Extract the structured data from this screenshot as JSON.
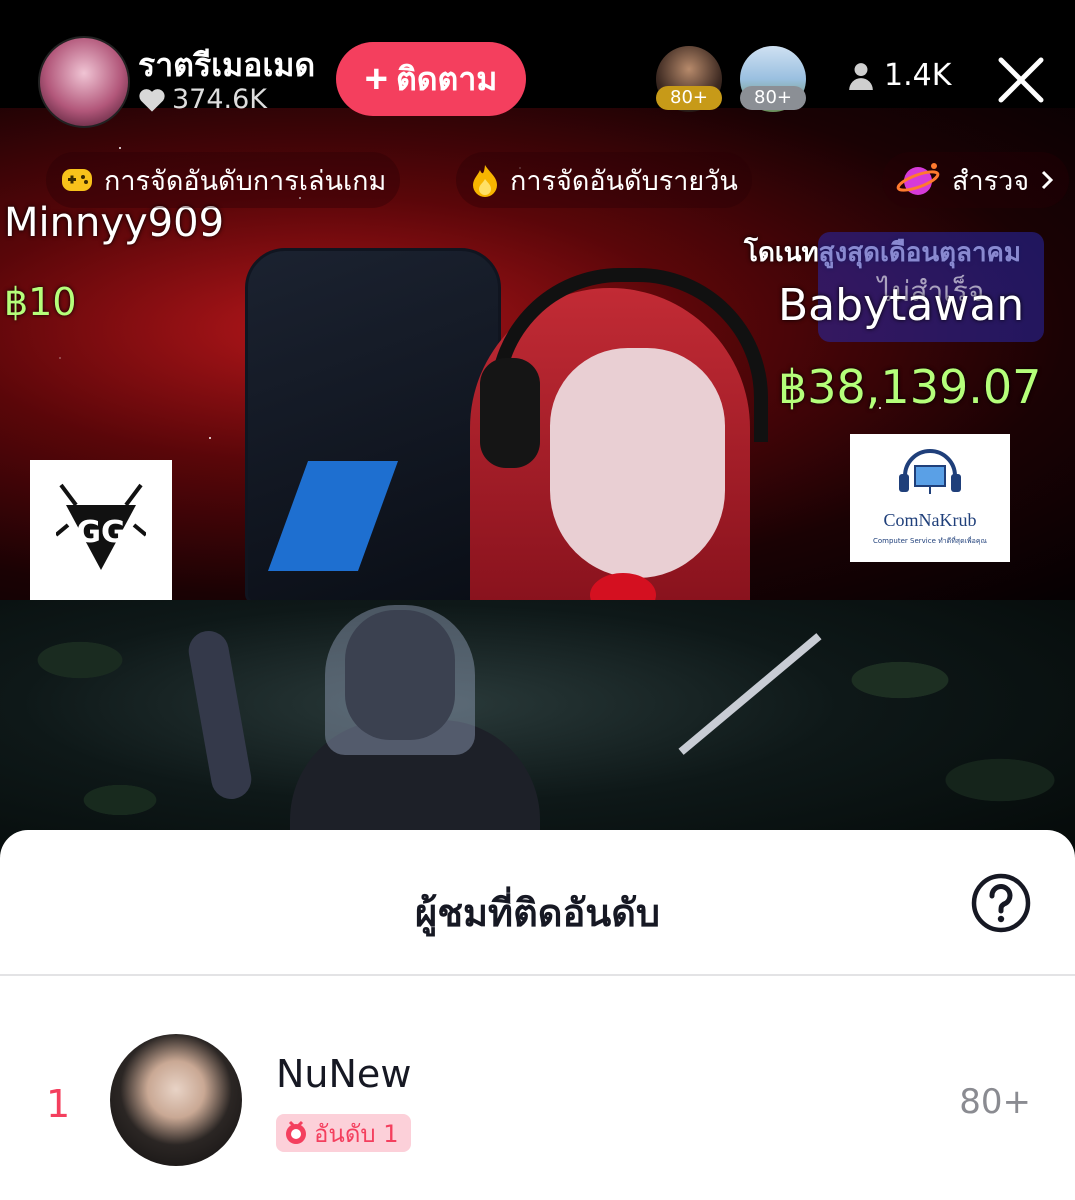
{
  "host": {
    "name": "ราตรีเมอเมด",
    "likes": "374.6K",
    "follow_label": "ติดตาม"
  },
  "top_viewers": [
    {
      "badge": "80+"
    },
    {
      "badge": "80+"
    }
  ],
  "viewer_count": "1.4K",
  "ranking_bar": {
    "game_ranking": "การจัดอันดับการเล่นเกม",
    "daily_ranking": "การจัดอันดับรายวัน",
    "explore": "สำรวจ"
  },
  "stream_overlay": {
    "left_donor_name": "Minnyy909",
    "left_donor_amount": "฿10",
    "top_donor_title": "โดเนทสูงสุดเดือนตุลาคม",
    "top_donor_name": "Babytawan",
    "top_donor_amount": "฿38,139.07",
    "status_text": "ไม่สำเร็จ",
    "sponsor_logo_text": "ComNaKrub",
    "sponsor_logo_tagline": "Computer Service ทำดีที่สุดเพื่อคุณ"
  },
  "sheet": {
    "title": "ผู้ชมที่ติดอันดับ",
    "rows": [
      {
        "rank": "1",
        "name": "NuNew",
        "badge": "อันดับ 1",
        "score": "80+"
      }
    ]
  },
  "colors": {
    "accent": "#f43f5e",
    "gold_badge": "#c79a18",
    "amount_green": "#b5ff7a"
  },
  "icons": [
    "heart-icon",
    "plus-icon",
    "person-icon",
    "close-icon",
    "gamepad-icon",
    "flame-icon",
    "planet-icon",
    "chevron-right-icon",
    "help-icon",
    "medal-icon"
  ]
}
